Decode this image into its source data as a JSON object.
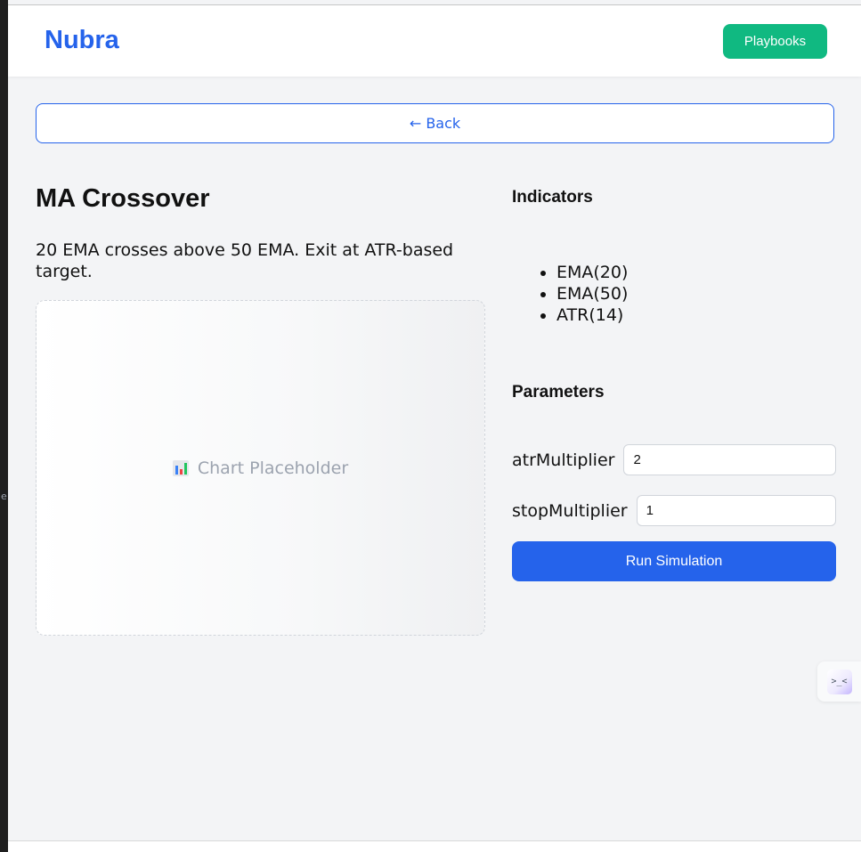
{
  "header": {
    "brand": "Nubra",
    "playbooks_label": "Playbooks"
  },
  "nav": {
    "back_label": "← Back"
  },
  "strategy": {
    "title": "MA Crossover",
    "description": "20 EMA crosses above 50 EMA. Exit at ATR-based target.",
    "chart_placeholder": "Chart Placeholder",
    "chart_icon": "bar-chart-icon"
  },
  "indicators": {
    "title": "Indicators",
    "items": [
      "EMA(20)",
      "EMA(50)",
      "ATR(14)"
    ]
  },
  "parameters": {
    "title": "Parameters",
    "fields": [
      {
        "label": "atrMultiplier",
        "value": "2"
      },
      {
        "label": "stopMultiplier",
        "value": "1"
      }
    ],
    "run_label": "Run Simulation"
  },
  "side_widget": {
    "icon": "assistant-face-icon",
    "glyph": ">_<"
  },
  "colors": {
    "brand": "#2563eb",
    "playbooks": "#10b981",
    "run": "#2563eb",
    "background": "#f3f4f6"
  }
}
